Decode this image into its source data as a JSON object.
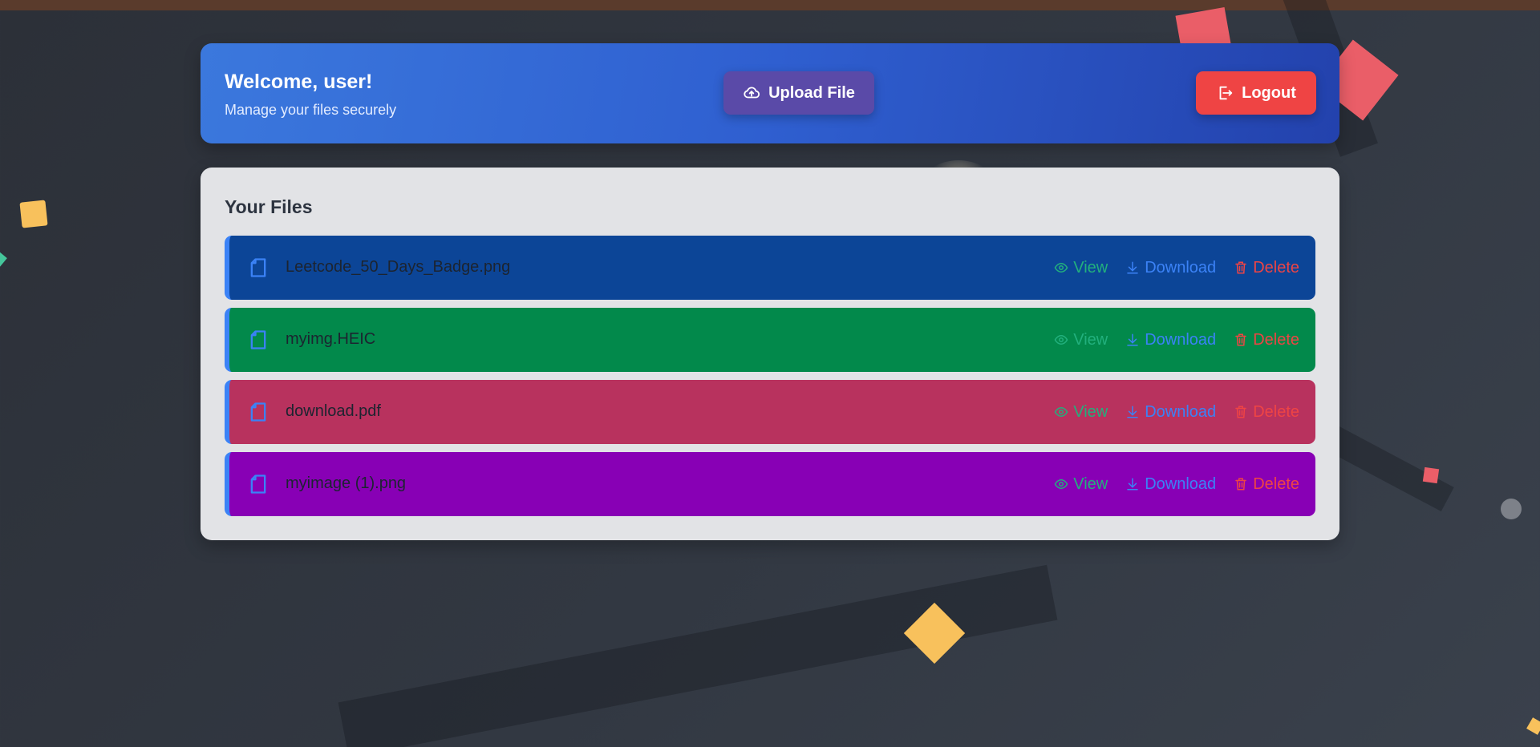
{
  "header": {
    "title": "Welcome, user!",
    "subtitle": "Manage your files securely",
    "upload_label": "Upload File",
    "logout_label": "Logout"
  },
  "files_section": {
    "title": "Your Files",
    "actions": {
      "view_label": "View",
      "download_label": "Download",
      "delete_label": "Delete"
    },
    "files": [
      {
        "name": "Leetcode_50_Days_Badge.png",
        "color": "#0c4597"
      },
      {
        "name": "myimg.HEIC",
        "color": "#02894b"
      },
      {
        "name": "download.pdf",
        "color": "#b8325e"
      },
      {
        "name": "myimage (1).png",
        "color": "#8800b5"
      }
    ]
  },
  "colors": {
    "header_gradient_start": "#3b78dd",
    "header_gradient_end": "#2342ad",
    "upload_button": "#5a4aa8",
    "logout_button": "#ef4444",
    "view_action": "#22b07d",
    "download_action": "#3b82f6",
    "delete_action": "#ef4444"
  }
}
